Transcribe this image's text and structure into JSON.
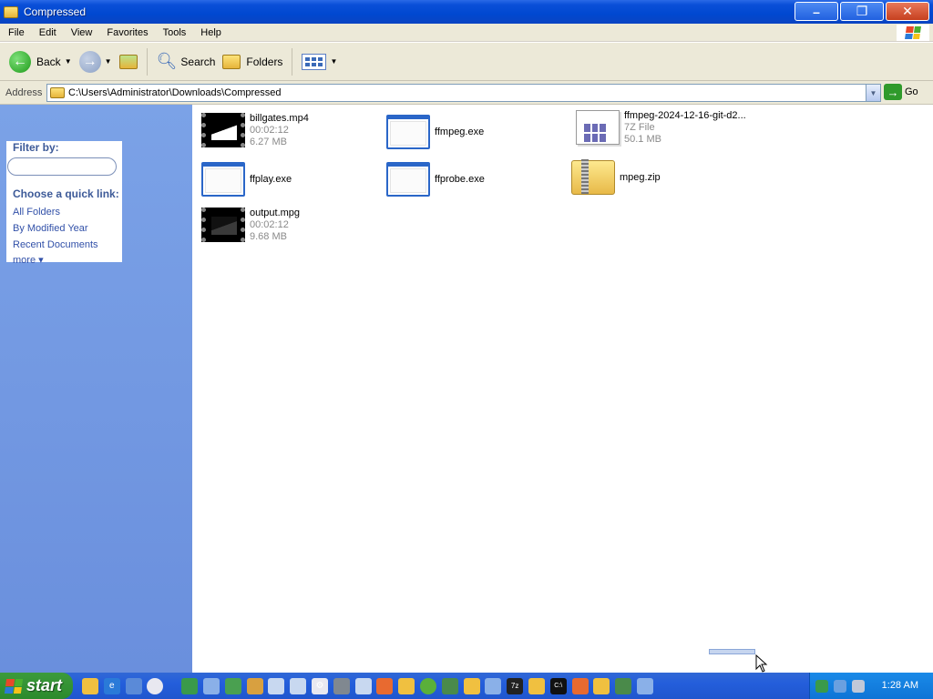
{
  "window": {
    "title": "Compressed",
    "buttons": {
      "minimize": "–",
      "restore": "❐",
      "close": "✕"
    }
  },
  "menubar": {
    "items": [
      "File",
      "Edit",
      "View",
      "Favorites",
      "Tools",
      "Help"
    ]
  },
  "toolbar": {
    "back_label": "Back",
    "search_label": "Search",
    "folders_label": "Folders"
  },
  "address": {
    "label": "Address",
    "path": "C:\\Users\\Administrator\\Downloads\\Compressed",
    "go_label": "Go"
  },
  "leftpane": {
    "filter_title": "Filter by:",
    "filter_value": "",
    "quick_title": "Choose a quick link:",
    "links": [
      "All Folders",
      "By Modified Year",
      "Recent Documents",
      "more ▾"
    ]
  },
  "files": [
    {
      "name": "billgates.mp4",
      "line2": "00:02:12",
      "line3": "6.27 MB",
      "icon": "video-icon"
    },
    {
      "name": "ffmpeg.exe",
      "line2": "",
      "line3": "",
      "icon": "exe-icon"
    },
    {
      "name": "ffmpeg-2024-12-16-git-d2...",
      "line2": "7Z File",
      "line3": "50.1 MB",
      "icon": "7z-file-icon"
    },
    {
      "name": "ffplay.exe",
      "line2": "",
      "line3": "",
      "icon": "exe-icon"
    },
    {
      "name": "ffprobe.exe",
      "line2": "",
      "line3": "",
      "icon": "exe-icon"
    },
    {
      "name": "mpeg.zip",
      "line2": "",
      "line3": "",
      "icon": "zip-folder-icon"
    },
    {
      "name": "output.mpg",
      "line2": "00:02:12",
      "line3": "9.68 MB",
      "icon": "video-icon"
    }
  ],
  "taskbar": {
    "start_label": "start",
    "clock": "1:28 AM"
  },
  "colors": {
    "titlebar": "#0048d0",
    "leftpane": "#7ba2e7",
    "taskbar": "#245edb",
    "start_button": "#3c9b3c",
    "tray": "#0e74d6"
  }
}
